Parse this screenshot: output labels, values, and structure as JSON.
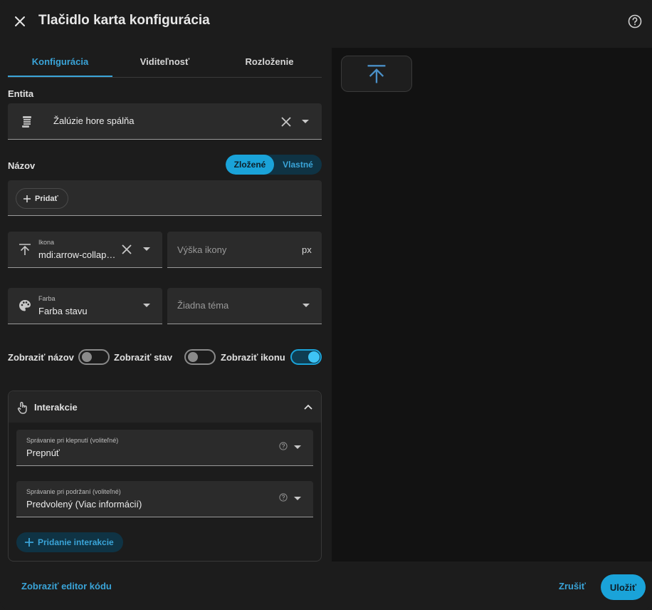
{
  "dialog": {
    "title": "Tlačidlo karta konfigurácia"
  },
  "tabs": [
    {
      "label": "Konfigurácia",
      "active": true
    },
    {
      "label": "Viditeľnosť",
      "active": false
    },
    {
      "label": "Rozloženie",
      "active": false
    }
  ],
  "entity": {
    "section_label": "Entita",
    "value": "Žalúzie hore spálňa",
    "icon": "blinds-icon"
  },
  "name": {
    "section_label": "Názov",
    "segment": [
      {
        "label": "Zložené",
        "selected": true
      },
      {
        "label": "Vlastné",
        "selected": false
      }
    ],
    "add_label": "Pridať"
  },
  "icon_field": {
    "label": "Ikona",
    "value": "mdi:arrow-collapse-up",
    "icon": "arrow-collapse-up-icon"
  },
  "icon_height": {
    "placeholder": "Výška ikony",
    "suffix": "px"
  },
  "color": {
    "label": "Farba",
    "value": "Farba stavu",
    "icon": "palette-icon"
  },
  "theme": {
    "placeholder": "Žiadna téma"
  },
  "toggles": [
    {
      "label": "Zobraziť názov",
      "on": false
    },
    {
      "label": "Zobraziť stav",
      "on": false
    },
    {
      "label": "Zobraziť ikonu",
      "on": true
    }
  ],
  "interactions": {
    "title": "Interakcie",
    "tap": {
      "label": "Správanie pri klepnutí (voliteľné)",
      "value": "Prepnúť"
    },
    "hold": {
      "label": "Správanie pri podržaní (voliteľné)",
      "value": "Predvolený (Viac informácií)"
    },
    "add_label": "Pridanie interakcie"
  },
  "footer": {
    "code_editor": "Zobraziť editor kódu",
    "cancel": "Zrušiť",
    "save": "Uložiť"
  },
  "colors": {
    "accent": "#1aa3d9",
    "background": "#1c1c1c",
    "field": "#2b2b2b",
    "preview_icon": "#4a90c8"
  }
}
